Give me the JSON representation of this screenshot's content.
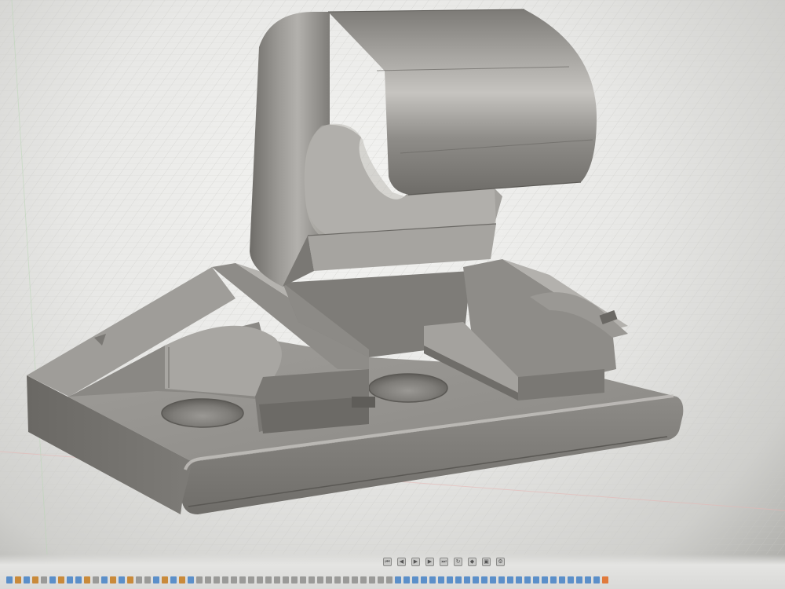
{
  "viewport": {
    "name": "3D model viewport",
    "model_color": "#8c8a86",
    "grid_color": "#c4c4c2",
    "background_color": "#ecece9"
  },
  "timeline": {
    "controls": [
      {
        "icon": "go-to-start-icon",
        "glyph": "⏮"
      },
      {
        "icon": "step-back-icon",
        "glyph": "◀"
      },
      {
        "icon": "play-icon",
        "glyph": "▶"
      },
      {
        "icon": "step-forward-icon",
        "glyph": "▶"
      },
      {
        "icon": "go-to-end-icon",
        "glyph": "⏭"
      },
      {
        "icon": "rotate-icon",
        "glyph": "↻"
      },
      {
        "icon": "highlight-icon",
        "glyph": "◆"
      },
      {
        "icon": "filter-icon",
        "glyph": "▣"
      },
      {
        "icon": "settings-icon",
        "glyph": "⚙"
      }
    ],
    "feature_colors": {
      "sketch": "#5b8fc9",
      "extrude": "#c98a3a",
      "fillet": "#9a9a98",
      "end_marker": "#e07a3c"
    }
  }
}
